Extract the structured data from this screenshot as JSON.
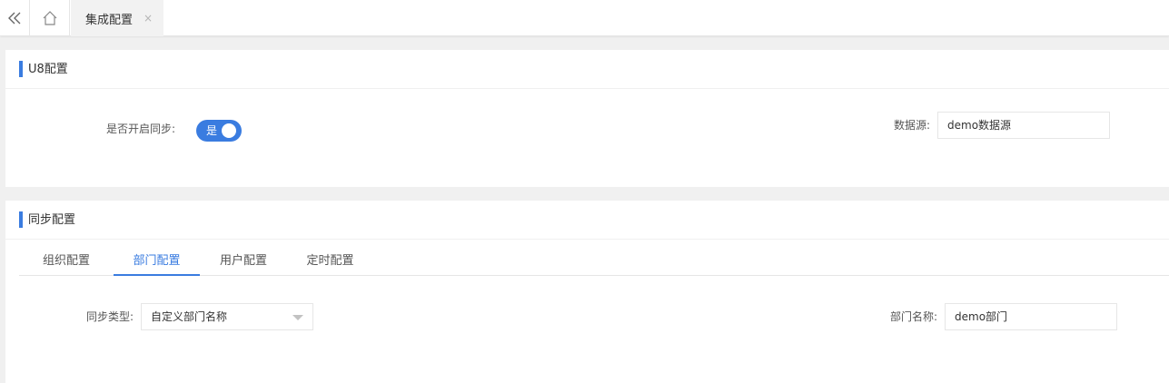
{
  "topbar": {
    "collapse_icon": "double-chevron-left-icon",
    "home_icon": "home-icon",
    "tab_label": "集成配置",
    "tab_close": "×"
  },
  "u8": {
    "title": "U8配置",
    "sync_label": "是否开启同步:",
    "sync_value": "是",
    "sync_on": true,
    "datasource_label": "数据源:",
    "datasource_value": "demo数据源"
  },
  "sync": {
    "title": "同步配置",
    "tabs": [
      "组织配置",
      "部门配置",
      "用户配置",
      "定时配置"
    ],
    "active_tab": 1,
    "type_label": "同步类型:",
    "type_value": "自定义部门名称",
    "dept_label": "部门名称:",
    "dept_value": "demo部门"
  },
  "colors": {
    "accent": "#3a7ce0",
    "background": "#f0f0f0"
  }
}
